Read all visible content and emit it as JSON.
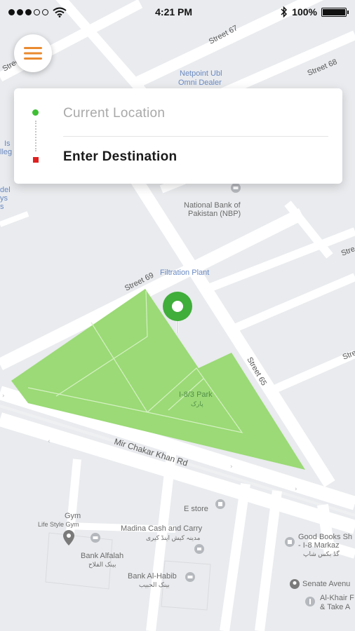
{
  "status_bar": {
    "time": "4:21 PM",
    "battery": "100%",
    "battery_level": 1.0,
    "signal_dots_filled": 3,
    "signal_dots_total": 5
  },
  "search_card": {
    "current_location": "Current Location",
    "destination": "Enter Destination"
  },
  "map": {
    "streets": {
      "street_67": "Street 67",
      "street_68": "Street 68",
      "street_69": "Street 69",
      "street_65": "Street 65",
      "street_upper_left": "Stree",
      "street_right_1": "Stre",
      "street_right_2": "Stre"
    },
    "road": "Mir Chakar Khan Rd",
    "pois": {
      "netpoint_1": "Netpoint Ubl",
      "netpoint_2": "Omni Dealer",
      "nbp_1": "National Bank of",
      "nbp_2": "Pakistan (NBP)",
      "filtration": "Filtration Plant",
      "park": "I-8/3 Park",
      "park_urdu": "پارک",
      "estore": "E store",
      "madina": "Madina Cash and Carry",
      "madina_urdu": "مدینہ کیش اینڈ کیری",
      "gym": "Gym",
      "lifestyle_gym": "Life Style Gym",
      "bank_alfalah": "Bank Alfalah",
      "bank_alfalah_urdu": "بینک الفلاح",
      "bank_alhabib": "Bank Al-Habib",
      "bank_alhabib_urdu": "بینک الحبیب",
      "good_books_1": "Good Books Sh",
      "good_books_2": "- I-8 Markaz",
      "good_books_urdu": "گڈ بکس شاپ",
      "senate": "Senate Avenu",
      "alkhair_1": "Al-Khair F",
      "alkhair_2": "& Take A",
      "left_edge_1": "Is",
      "left_edge_2": "lleg",
      "left_edge_3": "del",
      "left_edge_4": "ys",
      "left_edge_5": "s"
    }
  },
  "colors": {
    "park": "#9bda76",
    "pin": "#3fae3a",
    "menu_icon": "#e98a2f",
    "map_bg": "#e9ebee",
    "road": "#ffffff"
  }
}
